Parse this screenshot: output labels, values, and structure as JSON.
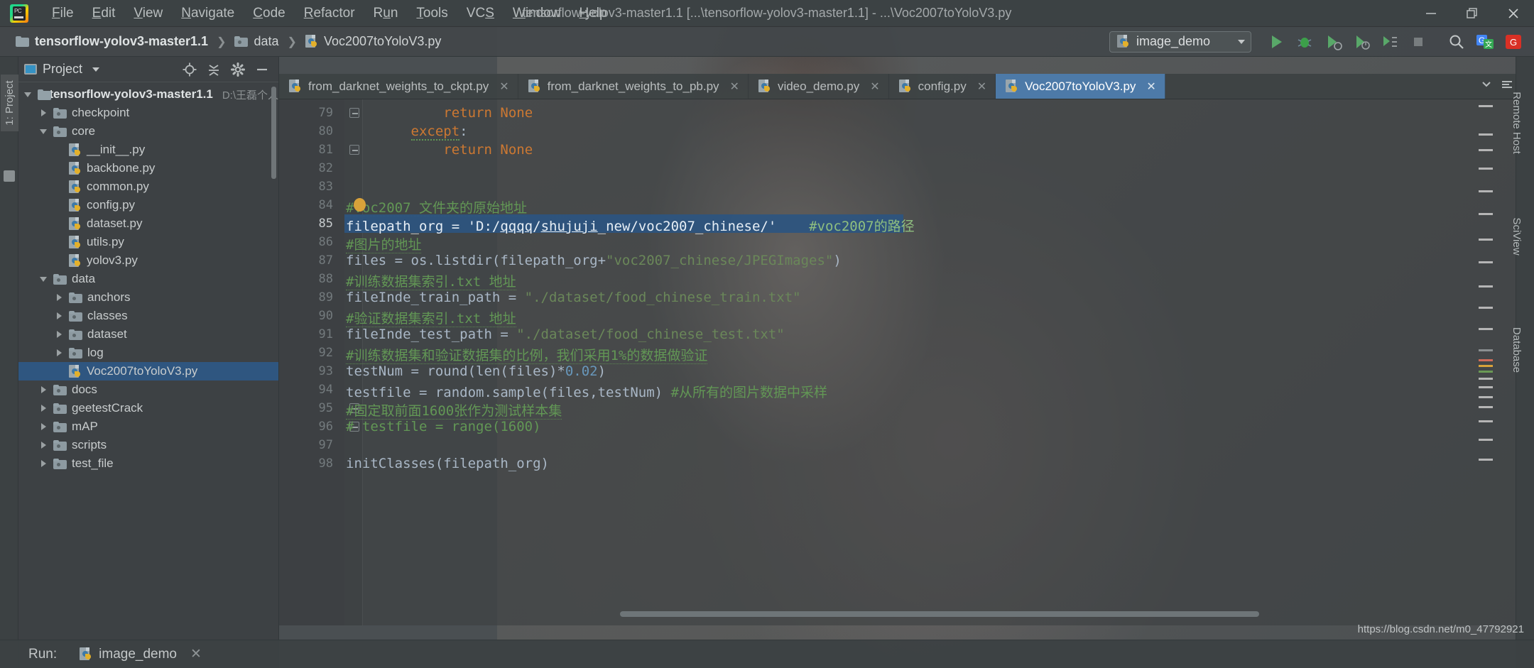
{
  "window": {
    "title": "tensorflow-yolov3-master1.1 [...\\tensorflow-yolov3-master1.1] - ...\\Voc2007toYoloV3.py",
    "minimize": "—",
    "restore": "❐",
    "close": "✕",
    "app_icon": "pycharm-logo"
  },
  "menubar": [
    {
      "label": "File",
      "accel": "F"
    },
    {
      "label": "Edit",
      "accel": "E"
    },
    {
      "label": "View",
      "accel": "V"
    },
    {
      "label": "Navigate",
      "accel": "N"
    },
    {
      "label": "Code",
      "accel": "C"
    },
    {
      "label": "Refactor",
      "accel": "R"
    },
    {
      "label": "Run",
      "accel": "u"
    },
    {
      "label": "Tools",
      "accel": "T"
    },
    {
      "label": "VCS",
      "accel": "S"
    },
    {
      "label": "Window",
      "accel": "W"
    },
    {
      "label": "Help",
      "accel": "H"
    }
  ],
  "breadcrumb": [
    {
      "label": "tensorflow-yolov3-master1.1",
      "icon": "folder-icon"
    },
    {
      "label": "data",
      "icon": "folder-icon"
    },
    {
      "label": "Voc2007toYoloV3.py",
      "icon": "python-file-icon"
    }
  ],
  "toolbar": {
    "run_config": "image_demo",
    "run_button": "run-icon",
    "debug_button": "debug-icon",
    "run_coverage_button": "run-coverage-icon",
    "profile_button": "profile-icon",
    "run_console_button": "run-console-icon",
    "stop_button": "stop-icon",
    "search_button": "search-icon",
    "translate_button": "translate-icon",
    "codota_button": "codota-icon"
  },
  "left_strip": {
    "project_tab": "1: Project",
    "structure_tab": "structure"
  },
  "right_strip": {
    "remote_host": "Remote Host",
    "scivew": "SciView",
    "database": "Database"
  },
  "project_panel": {
    "title": "Project",
    "locate_icon": "locate-icon",
    "collapse_icon": "collapse-all-icon",
    "settings_icon": "gear-icon",
    "hide_icon": "hide-icon",
    "tree": [
      {
        "label": "tensorflow-yolov3-master1.1",
        "path": "D:\\王磊个人",
        "indent": 0,
        "twisty": "down",
        "icon": "folder-icon",
        "kind": "root",
        "selected": false
      },
      {
        "label": "checkpoint",
        "indent": 1,
        "twisty": "right",
        "icon": "folder-icon",
        "kind": "folder",
        "selected": false
      },
      {
        "label": "core",
        "indent": 1,
        "twisty": "down",
        "icon": "folder-icon",
        "kind": "folder",
        "selected": false
      },
      {
        "label": "__init__.py",
        "indent": 2,
        "twisty": "none",
        "icon": "python-file-icon",
        "kind": "file",
        "selected": false
      },
      {
        "label": "backbone.py",
        "indent": 2,
        "twisty": "none",
        "icon": "python-file-icon",
        "kind": "file",
        "selected": false
      },
      {
        "label": "common.py",
        "indent": 2,
        "twisty": "none",
        "icon": "python-file-icon",
        "kind": "file",
        "selected": false
      },
      {
        "label": "config.py",
        "indent": 2,
        "twisty": "none",
        "icon": "python-file-icon",
        "kind": "file",
        "selected": false
      },
      {
        "label": "dataset.py",
        "indent": 2,
        "twisty": "none",
        "icon": "python-file-icon",
        "kind": "file",
        "selected": false
      },
      {
        "label": "utils.py",
        "indent": 2,
        "twisty": "none",
        "icon": "python-file-icon",
        "kind": "file",
        "selected": false
      },
      {
        "label": "yolov3.py",
        "indent": 2,
        "twisty": "none",
        "icon": "python-file-icon",
        "kind": "file",
        "selected": false
      },
      {
        "label": "data",
        "indent": 1,
        "twisty": "down",
        "icon": "folder-icon",
        "kind": "folder",
        "selected": false
      },
      {
        "label": "anchors",
        "indent": 2,
        "twisty": "right",
        "icon": "folder-icon",
        "kind": "folder",
        "selected": false
      },
      {
        "label": "classes",
        "indent": 2,
        "twisty": "right",
        "icon": "folder-icon",
        "kind": "folder",
        "selected": false
      },
      {
        "label": "dataset",
        "indent": 2,
        "twisty": "right",
        "icon": "folder-icon",
        "kind": "folder",
        "selected": false
      },
      {
        "label": "log",
        "indent": 2,
        "twisty": "right",
        "icon": "folder-icon",
        "kind": "folder",
        "selected": false
      },
      {
        "label": "Voc2007toYoloV3.py",
        "indent": 2,
        "twisty": "none",
        "icon": "python-file-icon",
        "kind": "file",
        "selected": true
      },
      {
        "label": "docs",
        "indent": 1,
        "twisty": "right",
        "icon": "folder-icon",
        "kind": "folder",
        "selected": false
      },
      {
        "label": "geetestCrack",
        "indent": 1,
        "twisty": "right",
        "icon": "folder-icon",
        "kind": "folder",
        "selected": false
      },
      {
        "label": "mAP",
        "indent": 1,
        "twisty": "right",
        "icon": "folder-icon",
        "kind": "folder",
        "selected": false
      },
      {
        "label": "scripts",
        "indent": 1,
        "twisty": "right",
        "icon": "folder-icon",
        "kind": "folder",
        "selected": false
      },
      {
        "label": "test_file",
        "indent": 1,
        "twisty": "right",
        "icon": "folder-icon",
        "kind": "folder",
        "selected": false
      }
    ]
  },
  "editor_tabs": [
    {
      "label": "from_darknet_weights_to_ckpt.py",
      "active": false,
      "close": "✕"
    },
    {
      "label": "from_darknet_weights_to_pb.py",
      "active": false,
      "close": "✕"
    },
    {
      "label": "video_demo.py",
      "active": false,
      "close": "✕"
    },
    {
      "label": "config.py",
      "active": false,
      "close": "✕"
    },
    {
      "label": "Voc2007toYoloV3.py",
      "active": true,
      "close": "✕"
    }
  ],
  "editor": {
    "first_line": 79,
    "selected_line": 85,
    "lines": [
      {
        "n": 79,
        "segments": [
          {
            "t": "            ",
            "c": "ident"
          },
          {
            "t": "return",
            "c": "kw"
          },
          {
            "t": " ",
            "c": "ident"
          },
          {
            "t": "None",
            "c": "kw"
          }
        ],
        "fold": "end"
      },
      {
        "n": 80,
        "segments": [
          {
            "t": "        ",
            "c": "ident"
          },
          {
            "t": "except",
            "c": "kw-squiggle"
          },
          {
            "t": ":",
            "c": "ident"
          }
        ]
      },
      {
        "n": 81,
        "segments": [
          {
            "t": "            ",
            "c": "ident"
          },
          {
            "t": "return",
            "c": "kw"
          },
          {
            "t": " ",
            "c": "ident"
          },
          {
            "t": "None",
            "c": "kw"
          }
        ],
        "fold": "end"
      },
      {
        "n": 82,
        "segments": []
      },
      {
        "n": 83,
        "segments": []
      },
      {
        "n": 84,
        "segments": [
          {
            "t": "#voc2007 文件夹的原始地址",
            "c": "cmt-dotted"
          }
        ],
        "bookmark": true
      },
      {
        "n": 85,
        "segments": [
          {
            "t": "filepath_org = ",
            "c": "ident"
          },
          {
            "t": "'D:/",
            "c": "str"
          },
          {
            "t": "qqqq",
            "c": "str-u"
          },
          {
            "t": "/",
            "c": "str"
          },
          {
            "t": "shujuji",
            "c": "str-u"
          },
          {
            "t": "_new/voc2007_chinese/'",
            "c": "str"
          },
          {
            "t": "    ",
            "c": "ident"
          },
          {
            "t": "#voc2007的路径",
            "c": "cmt"
          }
        ]
      },
      {
        "n": 86,
        "segments": [
          {
            "t": "#图片的地址",
            "c": "cmt-dotted"
          }
        ]
      },
      {
        "n": 87,
        "segments": [
          {
            "t": "files = os.listdir(filepath_org+",
            "c": "ident"
          },
          {
            "t": "\"voc2007_chinese/JPEGImages\"",
            "c": "str"
          },
          {
            "t": ")",
            "c": "ident"
          }
        ]
      },
      {
        "n": 88,
        "segments": [
          {
            "t": "#训练数据集索引.txt 地址",
            "c": "cmt-dotted"
          }
        ]
      },
      {
        "n": 89,
        "segments": [
          {
            "t": "fileInde_train_path = ",
            "c": "ident"
          },
          {
            "t": "\"./dataset/food_chinese_train.txt\"",
            "c": "str"
          }
        ]
      },
      {
        "n": 90,
        "segments": [
          {
            "t": "#验证数据集索引.txt 地址",
            "c": "cmt-dotted"
          }
        ]
      },
      {
        "n": 91,
        "segments": [
          {
            "t": "fileInde_test_path = ",
            "c": "ident"
          },
          {
            "t": "\"./dataset/food_chinese_test.txt\"",
            "c": "str"
          }
        ]
      },
      {
        "n": 92,
        "segments": [
          {
            "t": "#训练数据集和验证数据集的比例，我们采用1%的数据做验证",
            "c": "cmt-dotted"
          }
        ]
      },
      {
        "n": 93,
        "segments": [
          {
            "t": "testNum = round(len(files)*",
            "c": "ident"
          },
          {
            "t": "0.02",
            "c": "num"
          },
          {
            "t": ")",
            "c": "ident"
          }
        ]
      },
      {
        "n": 94,
        "segments": [
          {
            "t": "testfile = random.sample(files,testNum)",
            "c": "ident"
          },
          {
            "t": " #从所有的图片数据中采样",
            "c": "cmt"
          }
        ]
      },
      {
        "n": 95,
        "segments": [
          {
            "t": "#固定取前面1600张作为测试样本集",
            "c": "cmt-dotted"
          }
        ],
        "fold": "start"
      },
      {
        "n": 96,
        "segments": [
          {
            "t": "# testfile = range(1600)",
            "c": "cmt"
          }
        ],
        "fold": "end"
      },
      {
        "n": 97,
        "segments": []
      },
      {
        "n": 98,
        "segments": [
          {
            "t": "initClasses(filepath_org)",
            "c": "ident"
          }
        ]
      }
    ]
  },
  "bottom": {
    "run_label": "Run:",
    "run_config_label": "image_demo",
    "close_tab": "✕"
  },
  "watermark": "https://blog.csdn.net/m0_47792921",
  "colors": {
    "accent_blue": "#4d7aa8",
    "selection_blue": "#2d5580",
    "comment_green": "#629755",
    "string_green": "#6a8759",
    "keyword_orange": "#cc7832",
    "number_blue": "#6897bb",
    "bookmark_gold": "#d9a23a",
    "panel_bg": "#3c4143",
    "editor_bg": "#3c3f41"
  }
}
